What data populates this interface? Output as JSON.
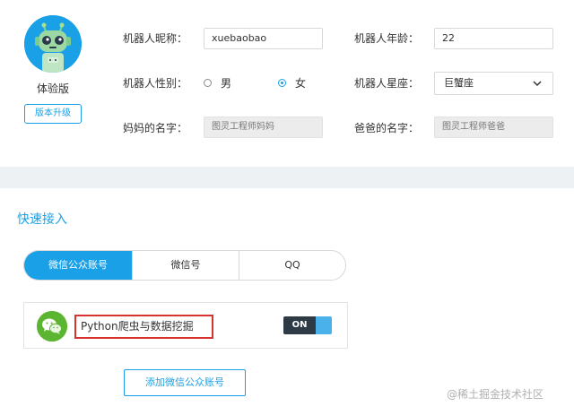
{
  "profile": {
    "version_name": "体验版",
    "upgrade_label": "版本升级",
    "nickname": {
      "label": "机器人昵称：",
      "value": "xuebaobao"
    },
    "age": {
      "label": "机器人年龄：",
      "value": "22"
    },
    "gender": {
      "label": "机器人性别：",
      "options": [
        "男",
        "女"
      ],
      "selected": "女"
    },
    "constellation": {
      "label": "机器人星座：",
      "value": "巨蟹座"
    },
    "mother": {
      "label": "妈妈的名字：",
      "placeholder": "图灵工程师妈妈"
    },
    "father": {
      "label": "爸爸的名字：",
      "placeholder": "图灵工程师爸爸"
    }
  },
  "quick_access": {
    "title": "快速接入",
    "tabs": [
      {
        "label": "微信公众账号",
        "active": true
      },
      {
        "label": "微信号",
        "active": false
      },
      {
        "label": "QQ",
        "active": false
      }
    ],
    "account": {
      "name": "Python爬虫与数据挖掘",
      "toggle_label": "ON"
    },
    "add_button": "添加微信公众账号"
  },
  "watermark": "@稀土掘金技术社区",
  "colors": {
    "accent": "#1aa0e6",
    "wechat_green": "#5cb531",
    "highlight_red": "#d8322f",
    "toggle_dark": "#2e3a46"
  },
  "icons": {
    "avatar": "robot-avatar",
    "wechat": "wechat-icon",
    "chevron": "chevron-down-icon"
  }
}
